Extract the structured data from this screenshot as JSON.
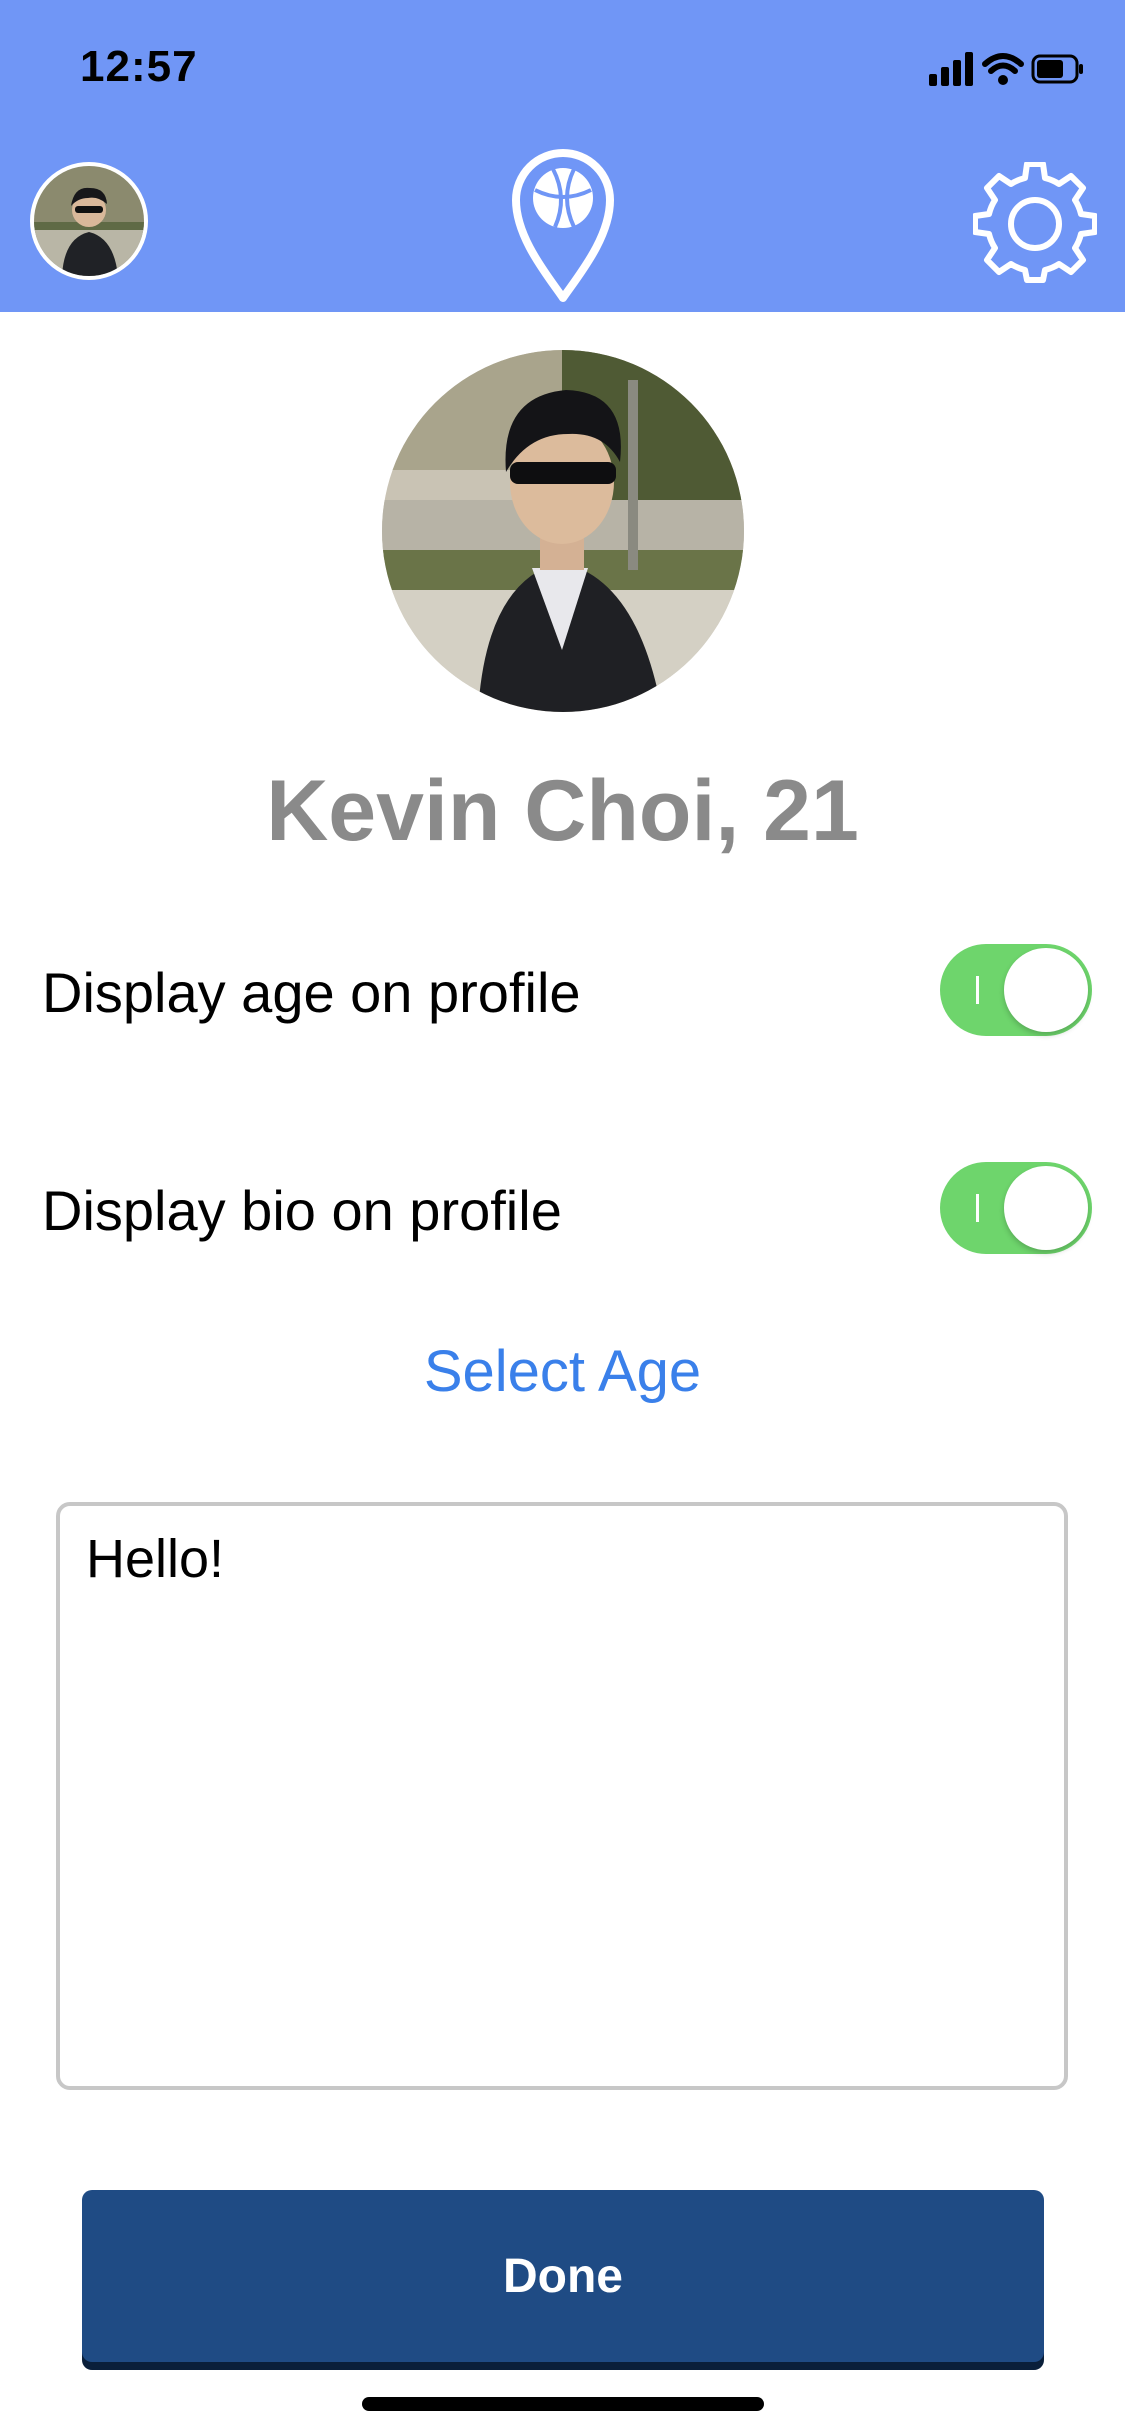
{
  "status_bar": {
    "time": "12:57"
  },
  "header": {
    "avatar_icon": "profile-photo",
    "logo_icon": "basketball-location-pin-icon",
    "settings_icon": "gear-icon"
  },
  "profile": {
    "name": "Kevin Choi, 21"
  },
  "settings": {
    "display_age_label": "Display age on profile",
    "display_age_on": true,
    "display_bio_label": "Display bio on profile",
    "display_bio_on": true
  },
  "select_age_label": "Select Age",
  "bio": {
    "value": "Hello!"
  },
  "done_label": "Done",
  "colors": {
    "header_bg": "#7096f6",
    "toggle_on": "#6ed56c",
    "link": "#3a80ea",
    "button": "#1f4b84"
  }
}
